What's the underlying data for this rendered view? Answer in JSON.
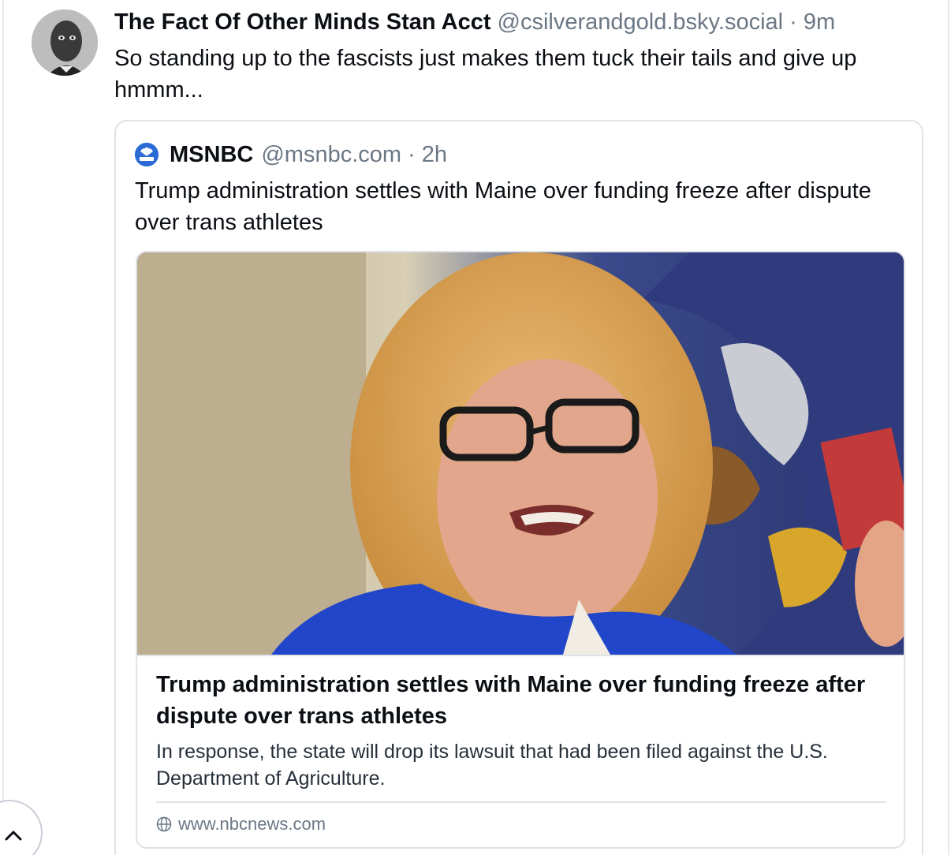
{
  "post": {
    "author_name": "The Fact Of Other Minds Stan Acct",
    "author_handle": "@csilverandgold.bsky.social",
    "separator": "·",
    "time": "9m",
    "text": "So standing up to the fascists just makes them tuck their tails and give up hmmm..."
  },
  "quote": {
    "author_name": "MSNBC",
    "author_handle": "@msnbc.com",
    "separator": "·",
    "time": "2h",
    "text": "Trump administration settles with Maine over funding freeze after dispute over trans athletes"
  },
  "link_card": {
    "title": "Trump administration settles with Maine over funding freeze after dispute over trans athletes",
    "description": "In response, the state will drop its lawsuit that had been filed against the U.S. Department of Agriculture.",
    "domain": "www.nbcnews.com"
  },
  "icons": {
    "avatar": "avatar",
    "msnbc_logo": "msnbc-peacock-icon",
    "globe": "globe-icon",
    "scroll_top": "chevron-up-icon"
  },
  "colors": {
    "text": "#0b0f14",
    "muted": "#6b7785",
    "border": "#dfe3e8",
    "brand_blue": "#2b6bd6"
  }
}
